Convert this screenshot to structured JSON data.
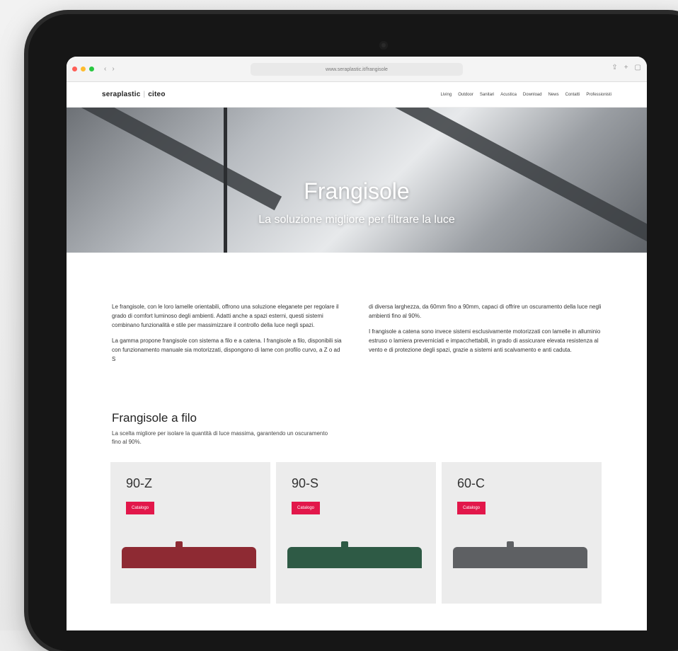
{
  "browser": {
    "url": "www.seraplastic.it/frangisole",
    "nav_back": "‹",
    "nav_forward": "›",
    "right_icons": [
      "share-icon",
      "new-tab-icon",
      "tabs-icon"
    ]
  },
  "site": {
    "logo_part1": "seraplastic",
    "logo_part2": "citeo",
    "nav": [
      "Living",
      "Outdoor",
      "Sanitari",
      "Acustica",
      "Download",
      "News",
      "Contatti",
      "Professionisti"
    ]
  },
  "hero": {
    "title": "Frangisole",
    "subtitle": "La soluzione migliore per filtrare la luce"
  },
  "intro": {
    "col1_p1": "Le frangisole, con le loro lamelle orientabili, offrono una soluzione eleganete per regolare il grado di comfort luminoso degli ambienti. Adatti anche a spazi esterni, questi sistemi combinano funzionalità e stile per massimizzare il controllo della luce negli spazi.",
    "col1_p2": "La gamma propone frangisole con sistema a filo e a catena. I frangisole a filo, disponibili sia con funzionamento manuale sia motorizzati, dispongono di lame con profilo curvo, a Z o ad S",
    "col2_p1": "di diversa larghezza, da 60mm fino a 90mm, capaci di offrire un oscuramento della luce negli ambienti fino al 90%.",
    "col2_p2": "I frangisole a catena sono invece sistemi esclusivamente motorizzati con lamelle in alluminio estruso o lamiera preverniciati e impacchettabili, in grado di assicurare elevata resistenza al vento e di protezione degli spazi, grazie a sistemi anti scalvamento e anti caduta."
  },
  "section": {
    "title": "Frangisole a filo",
    "desc": "La scelta migliore per isolare la quantità di luce massima, garantendo un oscuramento fino al 90%."
  },
  "cards": [
    {
      "name": "90-Z",
      "badge": "Catalogo",
      "color": "#8e2a33"
    },
    {
      "name": "90-S",
      "badge": "Catalogo",
      "color": "#2e5a45"
    },
    {
      "name": "60-C",
      "badge": "Catalogo",
      "color": "#5e6063"
    }
  ],
  "colors": {
    "accent": "#e2174a"
  }
}
